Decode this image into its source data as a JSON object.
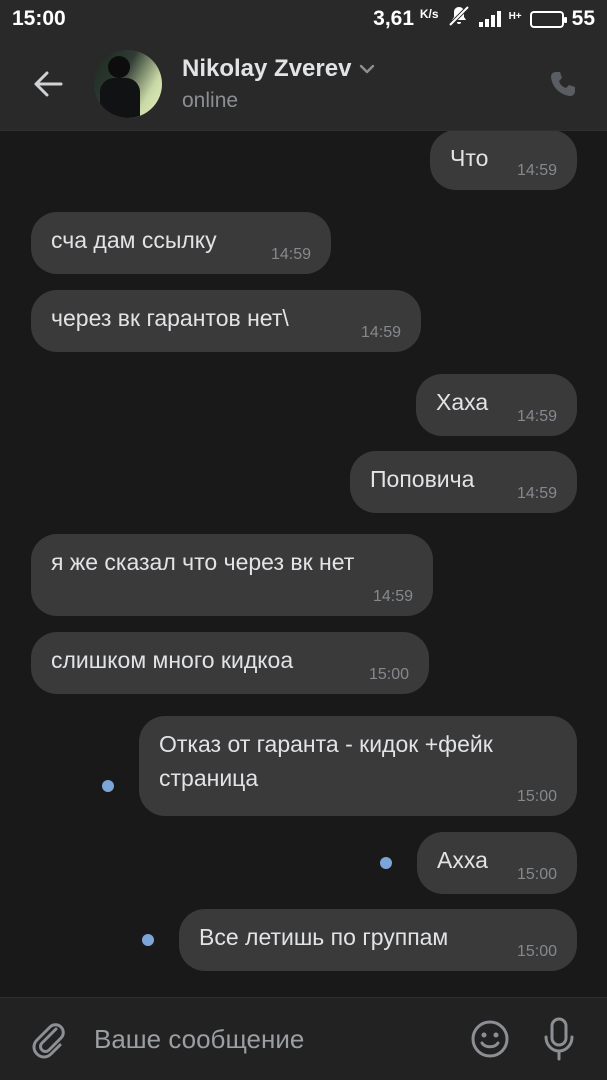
{
  "status_bar": {
    "time": "15:00",
    "speed": "3,61",
    "speed_unit": "K/s",
    "network": "H+",
    "battery": "55",
    "battery_level": 0.55
  },
  "header": {
    "back_icon": "arrow-left-icon",
    "contact_name": "Nikolay Zverev",
    "presence": "online",
    "call_icon": "phone-icon"
  },
  "messages": [
    {
      "direction": "out",
      "text": "Что",
      "time": "14:59",
      "unread": false
    },
    {
      "direction": "in",
      "text": "сча дам ссылку",
      "time": "14:59",
      "unread": false
    },
    {
      "direction": "in",
      "text": "через вк гарантов нет\\",
      "time": "14:59",
      "unread": false
    },
    {
      "direction": "out",
      "text": "Хаха",
      "time": "14:59",
      "unread": false
    },
    {
      "direction": "out",
      "text": "Поповича",
      "time": "14:59",
      "unread": false
    },
    {
      "direction": "in",
      "text": "я же сказал что через вк нет",
      "time": "14:59",
      "unread": false
    },
    {
      "direction": "in",
      "text": "слишком много кидкоа",
      "time": "15:00",
      "unread": false
    },
    {
      "direction": "out",
      "text": "Отказ от гаранта - кидок +фейк\nстраница",
      "time": "15:00",
      "unread": true
    },
    {
      "direction": "out",
      "text": "Ахха",
      "time": "15:00",
      "unread": true
    },
    {
      "direction": "out",
      "text": "Все летишь по группам",
      "time": "15:00",
      "unread": true
    }
  ],
  "composer": {
    "placeholder": "Ваше сообщение",
    "value": "",
    "attach_icon": "paperclip-icon",
    "emoji_icon": "smile-icon",
    "mic_icon": "microphone-icon"
  },
  "colors": {
    "background": "#191919",
    "header": "#292929",
    "bubble": "#3a3a3a",
    "unread_dot": "#7da6d8"
  }
}
